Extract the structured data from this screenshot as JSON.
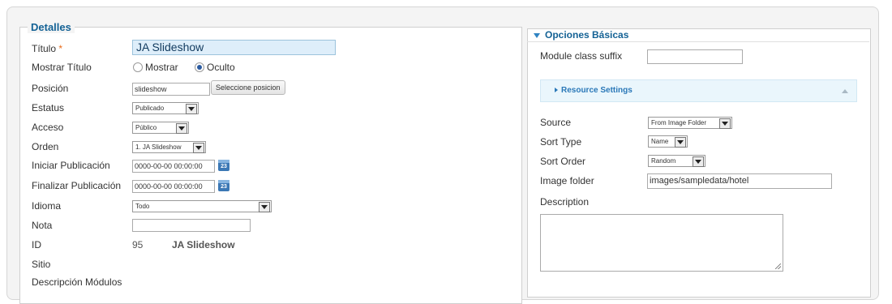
{
  "details": {
    "legend": "Detalles",
    "fields": {
      "title": {
        "label": "Título",
        "required_mark": "*",
        "value": "JA Slideshow"
      },
      "show_title": {
        "label": "Mostrar Título",
        "options": [
          "Mostrar",
          "Oculto"
        ],
        "selected": "Oculto"
      },
      "position": {
        "label": "Posición",
        "value": "slideshow",
        "button": "Seleccione posicion"
      },
      "status": {
        "label": "Estatus",
        "value": "Publicado"
      },
      "access": {
        "label": "Acceso",
        "value": "Público"
      },
      "order": {
        "label": "Orden",
        "value": "1. JA Slideshow"
      },
      "publish_up": {
        "label": "Iniciar Publicación",
        "value": "0000-00-00 00:00:00",
        "calendar_text": "23"
      },
      "publish_down": {
        "label": "Finalizar Publicación",
        "value": "0000-00-00 00:00:00",
        "calendar_text": "23"
      },
      "language": {
        "label": "Idioma",
        "value": "Todo"
      },
      "note": {
        "label": "Nota",
        "value": ""
      },
      "id": {
        "label": "ID",
        "value": "95",
        "name": "JA Slideshow"
      },
      "site": {
        "label": "Sitio"
      },
      "module_description": {
        "label": "Descripción Módulos"
      }
    }
  },
  "basic_options": {
    "title": "Opciones Básicas",
    "module_class_suffix": {
      "label": "Module class suffix",
      "value": ""
    },
    "resource_settings": {
      "title": "Resource Settings"
    },
    "source": {
      "label": "Source",
      "value": "From Image Folder"
    },
    "sort_type": {
      "label": "Sort Type",
      "value": "Name"
    },
    "sort_order": {
      "label": "Sort Order",
      "value": "Random"
    },
    "image_folder": {
      "label": "Image folder",
      "value": "images/sampledata/hotel"
    },
    "description": {
      "label": "Description",
      "value": ""
    }
  },
  "colors": {
    "accent": "#146295",
    "title_input_bg": "#deeefa",
    "required": "#e86b1b",
    "resource_bar": "#eaf6fc"
  }
}
